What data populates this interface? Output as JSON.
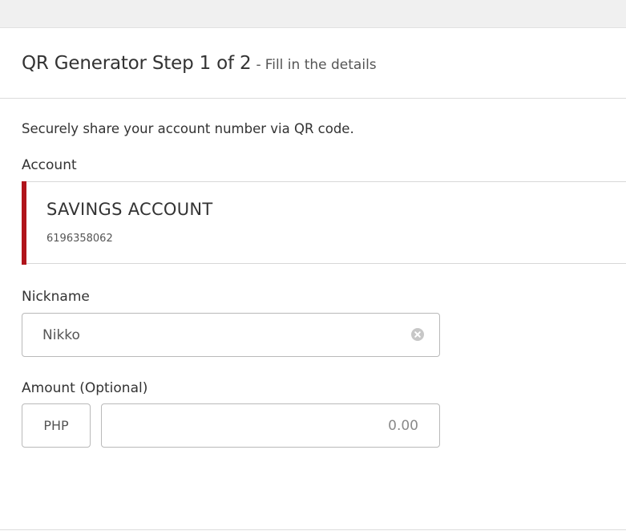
{
  "header": {
    "title": "QR Generator Step 1 of 2",
    "separator": "-",
    "subtitle": "Fill in the details"
  },
  "intro_text": "Securely share your account number via QR code.",
  "account_section": {
    "label": "Account",
    "card": {
      "type": "SAVINGS ACCOUNT",
      "number": "6196358062",
      "accent_color": "#b0141b"
    }
  },
  "nickname": {
    "label": "Nickname",
    "value": "Nikko",
    "clear_icon": "clear-circle-x-icon"
  },
  "amount": {
    "label": "Amount (Optional)",
    "currency": "PHP",
    "value": "",
    "placeholder": "0.00"
  }
}
